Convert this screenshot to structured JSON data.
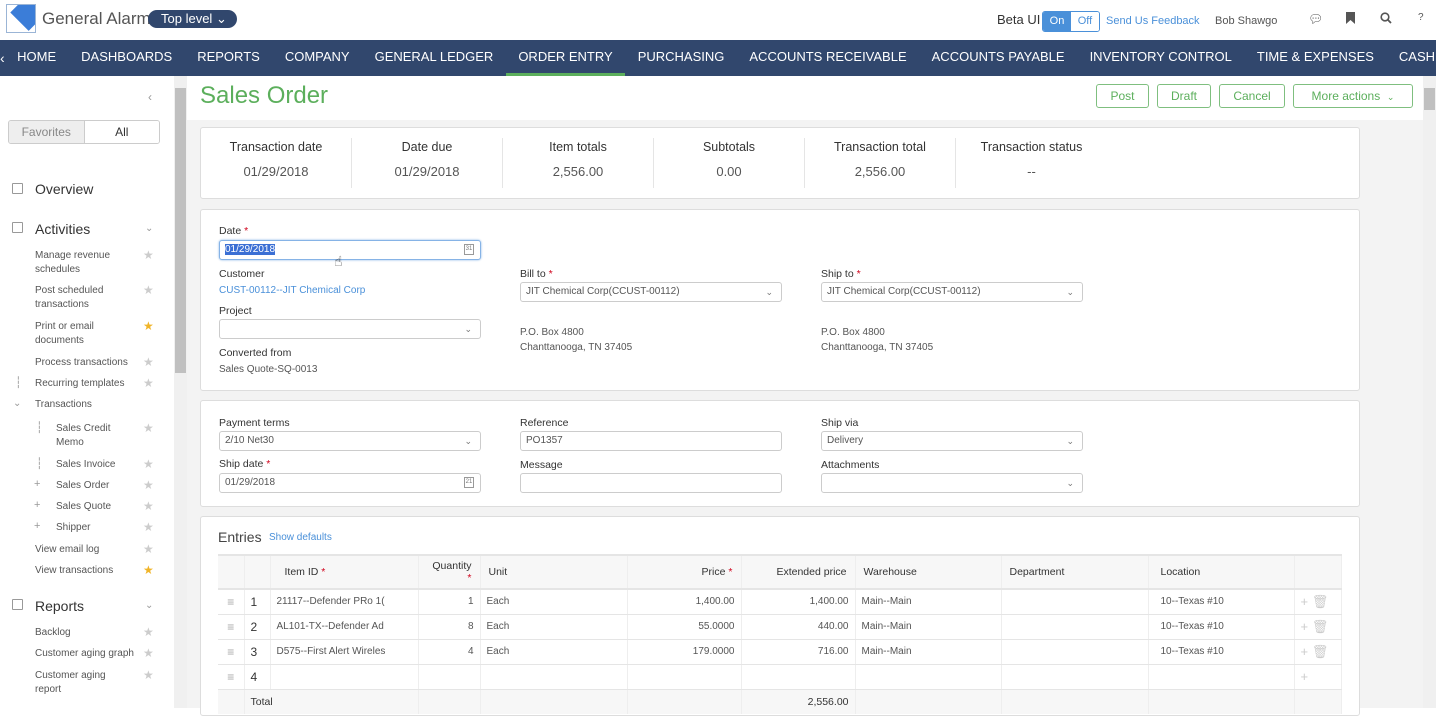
{
  "header": {
    "company": "General Alarm",
    "level_label": "Top level",
    "beta_label": "Beta UI",
    "toggle_on": "On",
    "toggle_off": "Off",
    "feedback_link": "Send Us Feedback",
    "user_name": "Bob Shawgo",
    "icons": [
      "chat-icon",
      "bookmark-icon",
      "search-icon",
      "help-icon"
    ]
  },
  "nav": {
    "prev": "‹",
    "next": "›",
    "items": [
      "HOME",
      "DASHBOARDS",
      "REPORTS",
      "COMPANY",
      "GENERAL LEDGER",
      "ORDER ENTRY",
      "PURCHASING",
      "ACCOUNTS RECEIVABLE",
      "ACCOUNTS PAYABLE",
      "INVENTORY CONTROL",
      "TIME & EXPENSES",
      "CASH MANA"
    ],
    "active": "ORDER ENTRY"
  },
  "sidebar": {
    "favorites_label": "Favorites",
    "all_label": "All",
    "overview": "Overview",
    "activities": "Activities",
    "activity_items": [
      {
        "label": "Manage revenue schedules",
        "fav": false
      },
      {
        "label": "Post scheduled transactions",
        "fav": false
      },
      {
        "label": "Print or email documents",
        "fav": true
      },
      {
        "label": "Process transactions",
        "fav": false
      },
      {
        "label": "Recurring templates",
        "fav": false
      }
    ],
    "transactions_label": "Transactions",
    "transaction_items": [
      {
        "label": "Sales Credit Memo",
        "fav": false
      },
      {
        "label": "Sales Invoice",
        "fav": false
      },
      {
        "label": "Sales Order",
        "fav": false
      },
      {
        "label": "Sales Quote",
        "fav": false
      },
      {
        "label": "Shipper",
        "fav": false
      }
    ],
    "more_items": [
      {
        "label": "View email log",
        "fav": false
      },
      {
        "label": "View transactions",
        "fav": true
      }
    ],
    "reports": "Reports",
    "report_items": [
      {
        "label": "Backlog",
        "fav": false
      },
      {
        "label": "Customer aging graph",
        "fav": false
      },
      {
        "label": "Customer aging report",
        "fav": false
      }
    ]
  },
  "page": {
    "title": "Sales Order",
    "actions": {
      "post": "Post",
      "draft": "Draft",
      "cancel": "Cancel",
      "more": "More actions"
    }
  },
  "summary": [
    {
      "label": "Transaction date",
      "value": "01/29/2018"
    },
    {
      "label": "Date due",
      "value": "01/29/2018"
    },
    {
      "label": "Item totals",
      "value": "2,556.00"
    },
    {
      "label": "Subtotals",
      "value": "0.00"
    },
    {
      "label": "Transaction total",
      "value": "2,556.00"
    },
    {
      "label": "Transaction status",
      "value": "--"
    }
  ],
  "header_form": {
    "date_label": "Date",
    "date_value": "01/29/2018",
    "customer_label": "Customer",
    "customer_value": "CUST-00112--JIT Chemical Corp",
    "project_label": "Project",
    "project_value": "",
    "converted_label": "Converted from",
    "converted_value": "Sales Quote-SQ-0013",
    "bill_to_label": "Bill to",
    "bill_to_value": "JIT Chemical Corp(CCUST-00112)",
    "bill_addr1": "P.O. Box 4800",
    "bill_addr2": "Chanttanooga, TN 37405",
    "ship_to_label": "Ship to",
    "ship_to_value": "JIT Chemical Corp(CCUST-00112)",
    "ship_addr1": "P.O. Box 4800",
    "ship_addr2": "Chanttanooga, TN 37405"
  },
  "terms_form": {
    "payment_terms_label": "Payment terms",
    "payment_terms_value": "2/10 Net30",
    "ship_date_label": "Ship date",
    "ship_date_value": "01/29/2018",
    "reference_label": "Reference",
    "reference_value": "PO1357",
    "message_label": "Message",
    "message_value": "",
    "ship_via_label": "Ship via",
    "ship_via_value": "Delivery",
    "attachments_label": "Attachments",
    "attachments_value": ""
  },
  "entries": {
    "title": "Entries",
    "show_defaults": "Show defaults",
    "columns": [
      "Item ID",
      "Quantity",
      "Unit",
      "Price",
      "Extended price",
      "Warehouse",
      "Department",
      "Location"
    ],
    "rows": [
      {
        "n": "1",
        "item": "21117--Defender PRo 1(",
        "qty": "1",
        "unit": "Each",
        "price": "1,400.00",
        "ext": "1,400.00",
        "wh": "Main--Main",
        "dept": "",
        "loc": "10--Texas #10"
      },
      {
        "n": "2",
        "item": "AL101-TX--Defender Ad",
        "qty": "8",
        "unit": "Each",
        "price": "55.0000",
        "ext": "440.00",
        "wh": "Main--Main",
        "dept": "",
        "loc": "10--Texas #10"
      },
      {
        "n": "3",
        "item": "D575--First Alert Wireles",
        "qty": "4",
        "unit": "Each",
        "price": "179.0000",
        "ext": "716.00",
        "wh": "Main--Main",
        "dept": "",
        "loc": "10--Texas #10"
      },
      {
        "n": "4",
        "item": "",
        "qty": "",
        "unit": "",
        "price": "",
        "ext": "",
        "wh": "",
        "dept": "",
        "loc": ""
      }
    ],
    "total_label": "Total",
    "total_value": "2,556.00"
  }
}
